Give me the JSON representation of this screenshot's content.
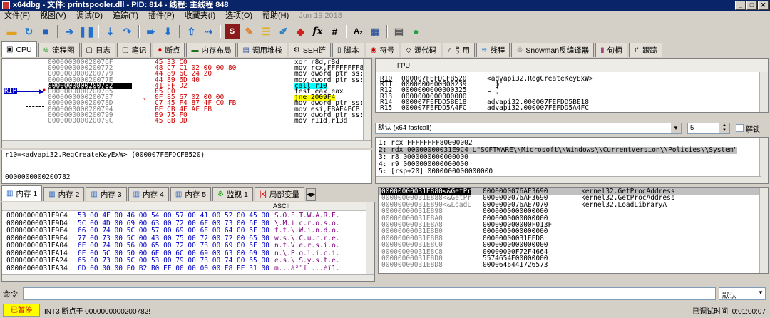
{
  "titlebar": {
    "title": "x64dbg - 文件: printspooler.dll - PID: 814 - 线程: 主线程 848",
    "controls": [
      "_",
      "□",
      "✕"
    ]
  },
  "menu": {
    "items": [
      "文件(F)",
      "视图(V)",
      "调试(D)",
      "追踪(T)",
      "插件(P)",
      "收藏夹(I)",
      "选项(O)",
      "帮助(H)"
    ],
    "date": "Jun 19 2018"
  },
  "toolbar": {
    "icons": [
      "open-icon",
      "restart-icon",
      "stop-icon",
      "run-icon",
      "pause-icon",
      "step-into-icon",
      "step-over-icon",
      "trace-into-icon",
      "trace-over-icon",
      "execute-till-return-icon",
      "run-to-user-code-icon",
      "script-icon",
      "patch-icon",
      "comment-icon",
      "label-icon",
      "bookmark-icon",
      "function-icon",
      "hash-icon",
      "font-icon",
      "calculator-icon",
      "database-icon",
      "globe-icon"
    ],
    "fx_label": "fx",
    "hash_label": "#",
    "font_label": "A₂"
  },
  "tabs": [
    {
      "label": "CPU",
      "icon": "cpu-icon"
    },
    {
      "label": "流程图",
      "icon": "graph-icon"
    },
    {
      "label": "日志",
      "icon": "log-icon"
    },
    {
      "label": "笔记",
      "icon": "notes-icon"
    },
    {
      "label": "断点",
      "icon": "breakpoint-icon"
    },
    {
      "label": "内存布局",
      "icon": "memory-map-icon"
    },
    {
      "label": "调用堆栈",
      "icon": "callstack-icon"
    },
    {
      "label": "SEH链",
      "icon": "seh-icon"
    },
    {
      "label": "脚本",
      "icon": "script-tab-icon"
    },
    {
      "label": "符号",
      "icon": "symbols-icon"
    },
    {
      "label": "源代码",
      "icon": "source-icon"
    },
    {
      "label": "引用",
      "icon": "references-icon"
    },
    {
      "label": "线程",
      "icon": "threads-icon"
    },
    {
      "label": "Snowman反编译器",
      "icon": "snowman-icon"
    },
    {
      "label": "句柄",
      "icon": "handles-icon"
    },
    {
      "label": "跟踪",
      "icon": "trace-icon"
    }
  ],
  "disasm": {
    "rip_label": "RIP",
    "rows": [
      {
        "addr": "000000000020076F",
        "bytes": "45 33 C0",
        "instr": "xor r8d,r8d"
      },
      {
        "addr": "0000000000200772",
        "bytes": "48 C7 C1 02 00 00 80",
        "instr": "mov rcx,FFFFFFFF8"
      },
      {
        "addr": "0000000000200779",
        "bytes": "44 89 6C 24 20",
        "instr": "mov dword ptr ss:"
      },
      {
        "addr": "000000000020077E",
        "bytes": "44 89 6D 40",
        "instr": "mov dword ptr ss:"
      },
      {
        "addr": "0000000000200782",
        "bytes": "41 FF D2",
        "instr": "call r10"
      },
      {
        "addr": "0000000000200785",
        "bytes": "85 C0",
        "instr": "test eax,eax"
      },
      {
        "addr": "0000000000200787",
        "bytes": "0F 85 67 02 00 00",
        "instr": "jne 2009F4"
      },
      {
        "addr": "000000000020078D",
        "bytes": "C7 45 F4 87 4F C0 FB",
        "instr": "mov dword ptr ss:"
      },
      {
        "addr": "0000000000200794",
        "bytes": "BE CB 4F AF FB",
        "instr": "mov esi,FBAF4FCB"
      },
      {
        "addr": "0000000000200799",
        "bytes": "89 75 F0",
        "instr": "mov dword ptr ss:"
      },
      {
        "addr": "000000000020079C",
        "bytes": "45 8B DD",
        "instr": "mov r11d,r13d"
      }
    ]
  },
  "info": {
    "line1": "r10=<advapi32.RegCreateKeyExW> (000007FEFDCFB520)",
    "line2": "0000000000200782"
  },
  "registers": {
    "header": "FPU",
    "rows": [
      {
        "name": "R10",
        "value": "000007FEFDCFB520",
        "comment": "<advapi32.RegCreateKeyExW>"
      },
      {
        "name": "R11",
        "value": "0000000000000239",
        "comment": "L'ɸ'"
      },
      {
        "name": "R12",
        "value": "0000000000000325",
        "comment": "L'̥'"
      },
      {
        "name": "R13",
        "value": "0000000000000000",
        "comment": ""
      },
      {
        "name": "R14",
        "value": "000007FEFDD5BE18",
        "comment": "advapi32.000007FEFDD5BE18"
      },
      {
        "name": "R15",
        "value": "000007FEFDD5A4FC",
        "comment": "advapi32.000007FEFDD5A4FC"
      }
    ]
  },
  "callconv": {
    "selected": "默认 (x64 fastcall)",
    "count": "5",
    "lock_label": "解锁"
  },
  "args": [
    "1: rcx FFFFFFFF80000002",
    "2: rdx 00000000031E9C4 L\"SOFTWARE\\\\Microsoft\\\\Windows\\\\CurrentVersion\\\\Policies\\\\System\"",
    "3: r8 0000000000000000",
    "4: r9 0000000000000000",
    "5: [rsp+20] 0000000000000000"
  ],
  "dumptabs": [
    {
      "label": "内存 1",
      "icon": "dump-icon"
    },
    {
      "label": "内存 2",
      "icon": "dump-icon"
    },
    {
      "label": "内存 3",
      "icon": "dump-icon"
    },
    {
      "label": "内存 4",
      "icon": "dump-icon"
    },
    {
      "label": "内存 5",
      "icon": "dump-icon"
    },
    {
      "label": "监视 1",
      "icon": "watch-icon"
    },
    {
      "label": "局部变量",
      "icon": "locals-icon"
    }
  ],
  "dump": {
    "header_ascii": "ASCII",
    "rows": [
      {
        "addr": "00000000031E9C4",
        "hex": "53 00 4F 00 46 00 54 00 57 00 41 00 52 00 45 00",
        "ascii": "S.O.F.T.W.A.R.E."
      },
      {
        "addr": "00000000031E9D4",
        "hex": "5C 00 4D 00 69 00 63 00 72 00 6F 00 73 00 6F 00",
        "ascii": "\\.M.i.c.r.o.s.o."
      },
      {
        "addr": "00000000031E9E4",
        "hex": "66 00 74 00 5C 00 57 00 69 00 6E 00 64 00 6F 00",
        "ascii": "f.t.\\.W.i.n.d.o."
      },
      {
        "addr": "00000000031E9F4",
        "hex": "77 00 73 00 5C 00 43 00 75 00 72 00 72 00 65 00",
        "ascii": "w.s.\\.C.u.r.r.e."
      },
      {
        "addr": "00000000031EA04",
        "hex": "6E 00 74 00 56 00 65 00 72 00 73 00 69 00 6F 00",
        "ascii": "n.t.V.e.r.s.i.o."
      },
      {
        "addr": "00000000031EA14",
        "hex": "6E 00 5C 00 50 00 6F 00 6C 00 69 00 63 00 69 00",
        "ascii": "n.\\.P.o.l.i.c.i."
      },
      {
        "addr": "00000000031EA24",
        "hex": "65 00 73 00 5C 00 53 00 79 00 73 00 74 00 65 00",
        "ascii": "e.s.\\.S.y.s.t.e."
      },
      {
        "addr": "00000000031EA34",
        "hex": "6D 00 00 00 E0 B2 B0 EE 00 00 00 00 E8 EE 31 00",
        "ascii": "m...à²°î....èî1."
      }
    ]
  },
  "stack": {
    "rows": [
      {
        "addr": "00000000031E880",
        "ref": "<&GetPr",
        "value": "0000000076AF3690",
        "comment": "kernel32.GetProcAddress"
      },
      {
        "addr": "00000000031E888",
        "ref": "<&GetPr",
        "value": "0000000076AF3690",
        "comment": "kernel32.GetProcAddress"
      },
      {
        "addr": "00000000031E890",
        "ref": "<&LoadL",
        "value": "0000000076AE7070",
        "comment": "kernel32.LoadLibraryA"
      },
      {
        "addr": "00000000031E898",
        "ref": "",
        "value": "0000000000000000",
        "comment": ""
      },
      {
        "addr": "00000000031E8A0",
        "ref": "",
        "value": "0000000000000000",
        "comment": ""
      },
      {
        "addr": "00000000031E8A8",
        "ref": "",
        "value": "000000000000F013F",
        "comment": ""
      },
      {
        "addr": "00000000031E8B0",
        "ref": "",
        "value": "0000000000000000",
        "comment": ""
      },
      {
        "addr": "00000000031E8B8",
        "ref": "",
        "value": "00000000031EED8",
        "comment": ""
      },
      {
        "addr": "00000000031E8C0",
        "ref": "",
        "value": "0000000000000000",
        "comment": ""
      },
      {
        "addr": "00000000031E8C8",
        "ref": "",
        "value": "00000000F72F4664",
        "comment": ""
      },
      {
        "addr": "00000000031E8D0",
        "ref": "",
        "value": "5574654E00000000",
        "comment": ""
      },
      {
        "addr": "00000000031E8D8",
        "ref": "",
        "value": "0000646441726573",
        "comment": ""
      }
    ]
  },
  "command": {
    "label": "命令:",
    "value": "",
    "mode": "默认"
  },
  "status": {
    "paused": "已暂停",
    "message": "INT3 断点于 0000000000200782!",
    "runtime_label": "已调试时间:",
    "runtime": "0:01:00:07"
  }
}
